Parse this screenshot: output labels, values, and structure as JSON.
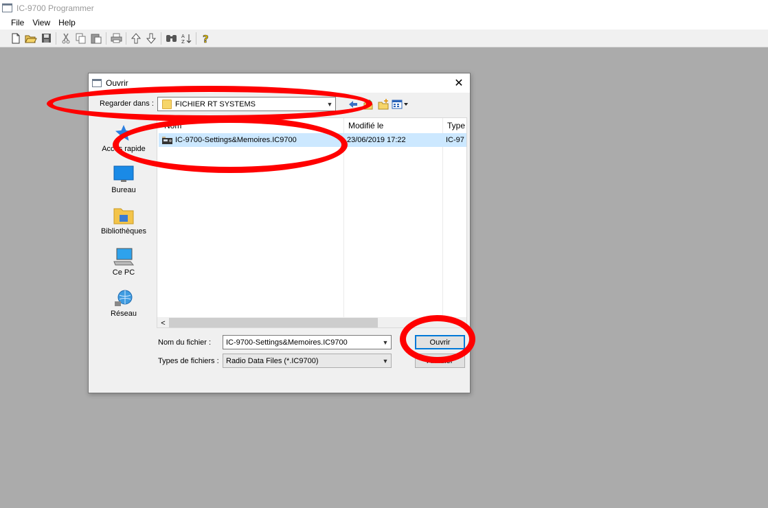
{
  "window": {
    "title": "IC-9700 Programmer",
    "menu": [
      "File",
      "View",
      "Help"
    ],
    "toolbar_icons": [
      "new-file-icon",
      "open-folder-icon",
      "save-icon",
      "cut-icon",
      "copy-icon",
      "paste-icon",
      "print-icon",
      "move-up-icon",
      "move-down-icon",
      "find-icon",
      "sort-icon",
      "help-icon"
    ]
  },
  "dialog": {
    "title": "Ouvrir",
    "close_glyph": "✕",
    "look_in_label": "Regarder dans :",
    "look_in_value": "FICHIER RT SYSTEMS",
    "places": [
      {
        "label": "Accès rapide",
        "icon": "quick-access-star-icon"
      },
      {
        "label": "Bureau",
        "icon": "desktop-icon"
      },
      {
        "label": "Bibliothèques",
        "icon": "libraries-icon"
      },
      {
        "label": "Ce PC",
        "icon": "this-pc-icon"
      },
      {
        "label": "Réseau",
        "icon": "network-icon"
      }
    ],
    "columns": [
      "Nom",
      "Modifié le",
      "Type"
    ],
    "files": [
      {
        "name": "IC-9700-Settings&Memoires.IC9700",
        "modified": "23/06/2019 17:22",
        "type": "IC-97",
        "selected": true
      }
    ],
    "file_name_label": "Nom du fichier :",
    "file_name_value": "IC-9700-Settings&Memoires.IC9700",
    "file_type_label": "Types de fichiers :",
    "file_type_value": "Radio Data Files (*.IC9700)",
    "open_button": "Ouvrir",
    "cancel_button": "Annuler"
  },
  "annotation_color": "#ff0000",
  "selection_color": "#cce8ff"
}
